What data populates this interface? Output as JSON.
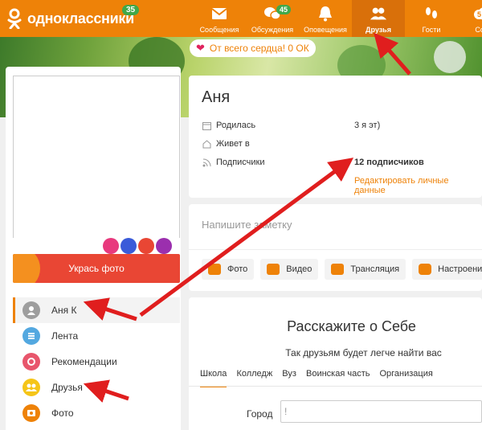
{
  "header": {
    "logo_text": "одноклассники",
    "logo_badge": "35",
    "nav": [
      {
        "label": "Сообщения",
        "icon": "envelope-icon",
        "badge": ""
      },
      {
        "label": "Обсуждения",
        "icon": "chat-bubbles-icon",
        "badge": "45"
      },
      {
        "label": "Оповещения",
        "icon": "bell-icon",
        "badge": ""
      },
      {
        "label": "Друзья",
        "icon": "friends-icon",
        "badge": "",
        "active": true
      },
      {
        "label": "Гости",
        "icon": "footprints-icon",
        "badge": ""
      },
      {
        "label": "Собы",
        "icon": "events-icon",
        "badge": "5"
      }
    ]
  },
  "cover": {
    "gift_text": "От всего сердца! 0 ОК"
  },
  "left": {
    "decorate_label": "Укрась фото",
    "menu": [
      {
        "label": "Аня К",
        "icon": "user-icon",
        "color": "#9e9e9e"
      },
      {
        "label": "Лента",
        "icon": "feed-icon",
        "color": "#53a8e0"
      },
      {
        "label": "Рекомендации",
        "icon": "recommendations-icon",
        "color": "#e8566c"
      },
      {
        "label": "Друзья",
        "icon": "friends-icon",
        "color": "#f5c518"
      },
      {
        "label": "Фото",
        "icon": "photo-icon",
        "color": "#ee8208"
      }
    ]
  },
  "profile": {
    "name": "Аня",
    "born_label": "Родилась",
    "born_value": "3 я                         эт)",
    "lives_label": "Живет в",
    "lives_value": "",
    "subscribers_label": "Подписчики",
    "subscribers_value": "12 подписчиков",
    "edit_label": "Редактировать личные данные"
  },
  "note": {
    "placeholder": "Напишите заметку",
    "actions": [
      "Фото",
      "Видео",
      "Трансляция",
      "Настроение"
    ]
  },
  "about": {
    "title": "Расскажите о Себе",
    "subtitle": "Так друзьям будет легче найти вас",
    "tabs": [
      "Школа",
      "Колледж",
      "Вуз",
      "Воинская часть",
      "Организация"
    ],
    "city_label": "Город",
    "city_value": "!"
  },
  "colors": {
    "accent": "#ee8208",
    "annotation_arrow": "#e01e1e"
  }
}
